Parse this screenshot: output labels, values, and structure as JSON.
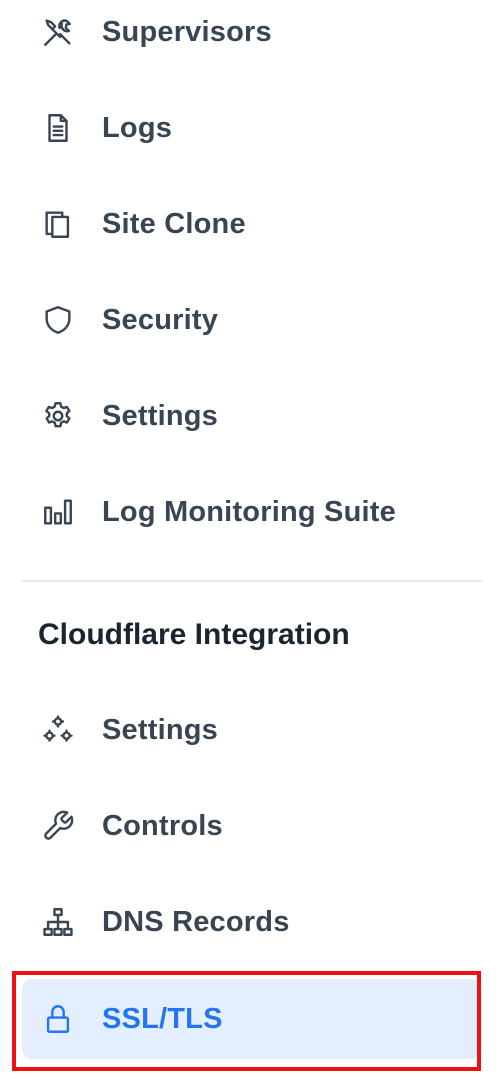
{
  "sidebar": {
    "items": [
      {
        "label": "Supervisors",
        "icon": "tools-icon"
      },
      {
        "label": "Logs",
        "icon": "document-icon"
      },
      {
        "label": "Site Clone",
        "icon": "copy-icon"
      },
      {
        "label": "Security",
        "icon": "shield-icon"
      },
      {
        "label": "Settings",
        "icon": "gear-icon"
      },
      {
        "label": "Log Monitoring Suite",
        "icon": "bar-chart-icon"
      }
    ],
    "section": {
      "title": "Cloudflare Integration",
      "items": [
        {
          "label": "Settings",
          "icon": "cogs-icon"
        },
        {
          "label": "Controls",
          "icon": "wrench-icon"
        },
        {
          "label": "DNS Records",
          "icon": "sitemap-icon"
        },
        {
          "label": "SSL/TLS",
          "icon": "lock-icon",
          "active": true
        }
      ]
    }
  },
  "colors": {
    "text": "#3a4553",
    "heading": "#1b2431",
    "active_text": "#2375f2",
    "active_bg": "#e3effe",
    "highlight_border": "#ee1111",
    "divider": "#e4e7eb"
  }
}
